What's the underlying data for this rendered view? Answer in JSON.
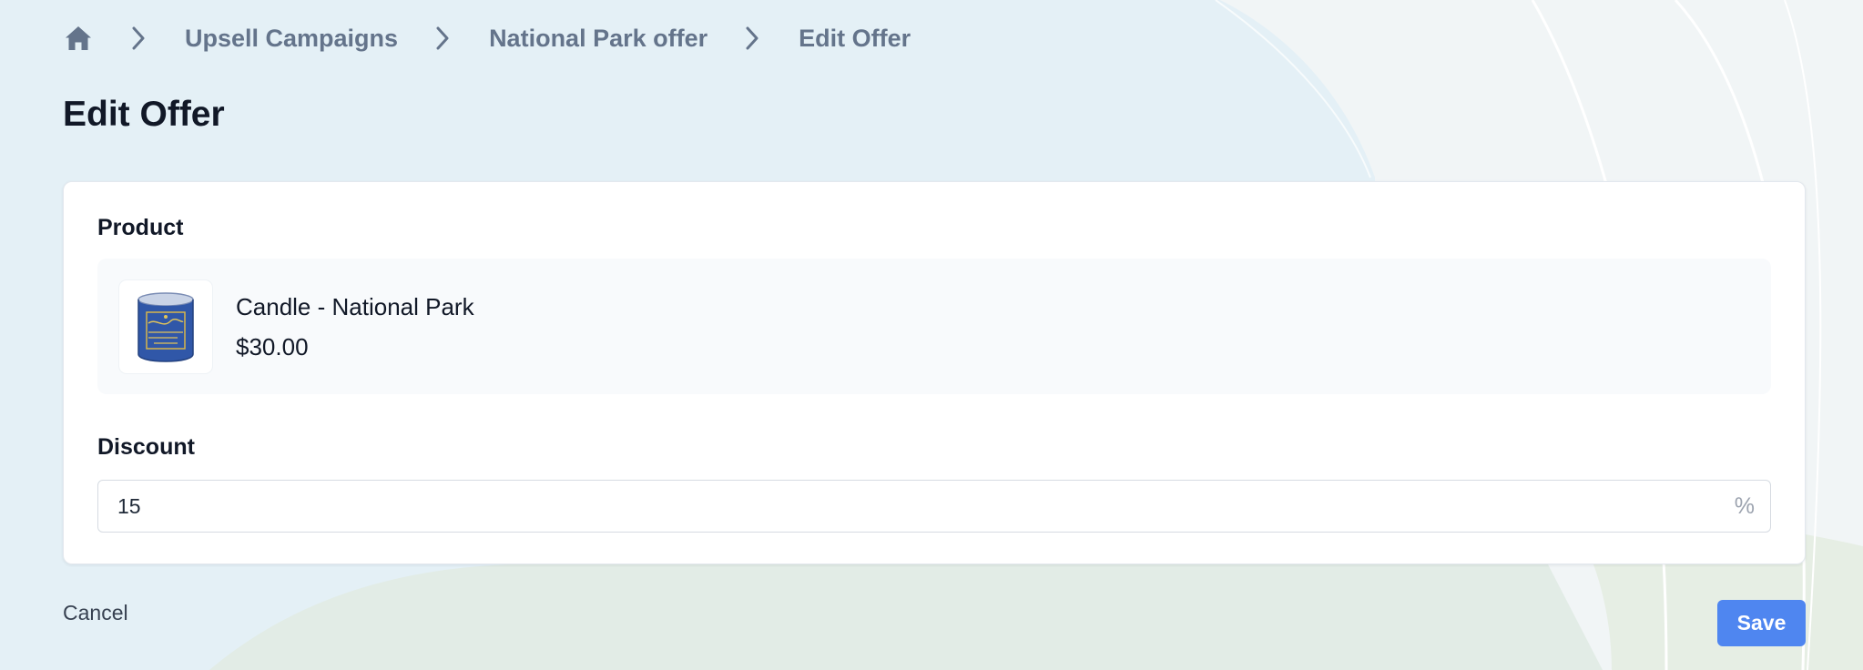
{
  "breadcrumb": {
    "home_icon": "home-icon",
    "separator_icon": "chevron-right-icon",
    "items": [
      {
        "label": "Upsell Campaigns"
      },
      {
        "label": "National Park offer"
      }
    ],
    "current": "Edit Offer"
  },
  "page": {
    "title": "Edit Offer"
  },
  "product": {
    "label": "Product",
    "name": "Candle - National Park",
    "price": "$30.00",
    "thumbnail_icon": "candle-tin-icon"
  },
  "discount": {
    "label": "Discount",
    "value": "15",
    "suffix": "%"
  },
  "actions": {
    "cancel_label": "Cancel",
    "save_label": "Save"
  },
  "colors": {
    "primary": "#4f86f0",
    "text": "#111827",
    "muted": "#64748b",
    "background": "#eef3f5"
  }
}
